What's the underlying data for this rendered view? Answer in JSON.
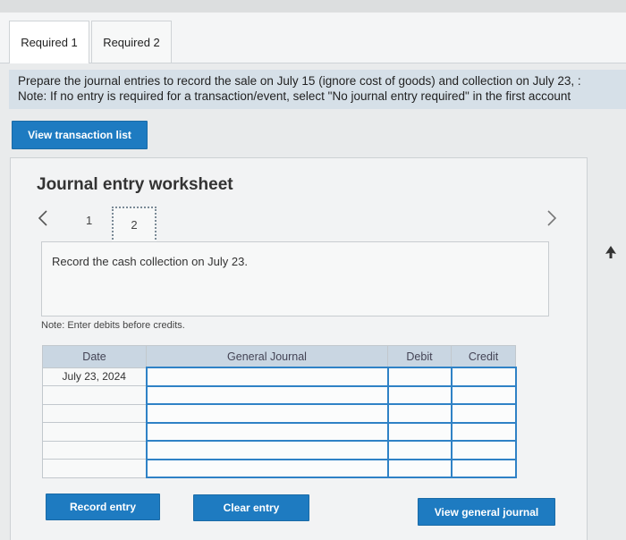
{
  "tabs": [
    {
      "label": "Required 1",
      "active": true
    },
    {
      "label": "Required 2",
      "active": false
    }
  ],
  "instructions": {
    "line1": "Prepare the journal entries to record the sale on July 15 (ignore cost of goods) and collection on July 23, :",
    "line2": "Note: If no entry is required for a transaction/event, select \"No journal entry required\" in the first account"
  },
  "buttons": {
    "view_transaction_list": "View transaction list",
    "record_entry": "Record entry",
    "clear_entry": "Clear entry",
    "view_general_journal": "View general journal"
  },
  "worksheet": {
    "title": "Journal entry worksheet",
    "pages": [
      "1",
      "2"
    ],
    "current_page": "2",
    "description": "Record the cash collection on July 23.",
    "note": "Note: Enter debits before credits."
  },
  "journal": {
    "headers": {
      "date": "Date",
      "account": "General Journal",
      "debit": "Debit",
      "credit": "Credit"
    },
    "rows": [
      {
        "date": "July 23, 2024",
        "account": "",
        "debit": "",
        "credit": ""
      },
      {
        "date": "",
        "account": "",
        "debit": "",
        "credit": ""
      },
      {
        "date": "",
        "account": "",
        "debit": "",
        "credit": ""
      },
      {
        "date": "",
        "account": "",
        "debit": "",
        "credit": ""
      },
      {
        "date": "",
        "account": "",
        "debit": "",
        "credit": ""
      },
      {
        "date": "",
        "account": "",
        "debit": "",
        "credit": ""
      }
    ]
  },
  "colors": {
    "button_blue": "#1e7bc1",
    "header_blue": "#c9d6e2",
    "instruction_bg": "#d6e0e8",
    "input_border": "#2f82c6"
  },
  "icons": {
    "prev": "chevron-left-icon",
    "next": "chevron-right-icon",
    "cursor": "mouse-pointer-icon"
  }
}
